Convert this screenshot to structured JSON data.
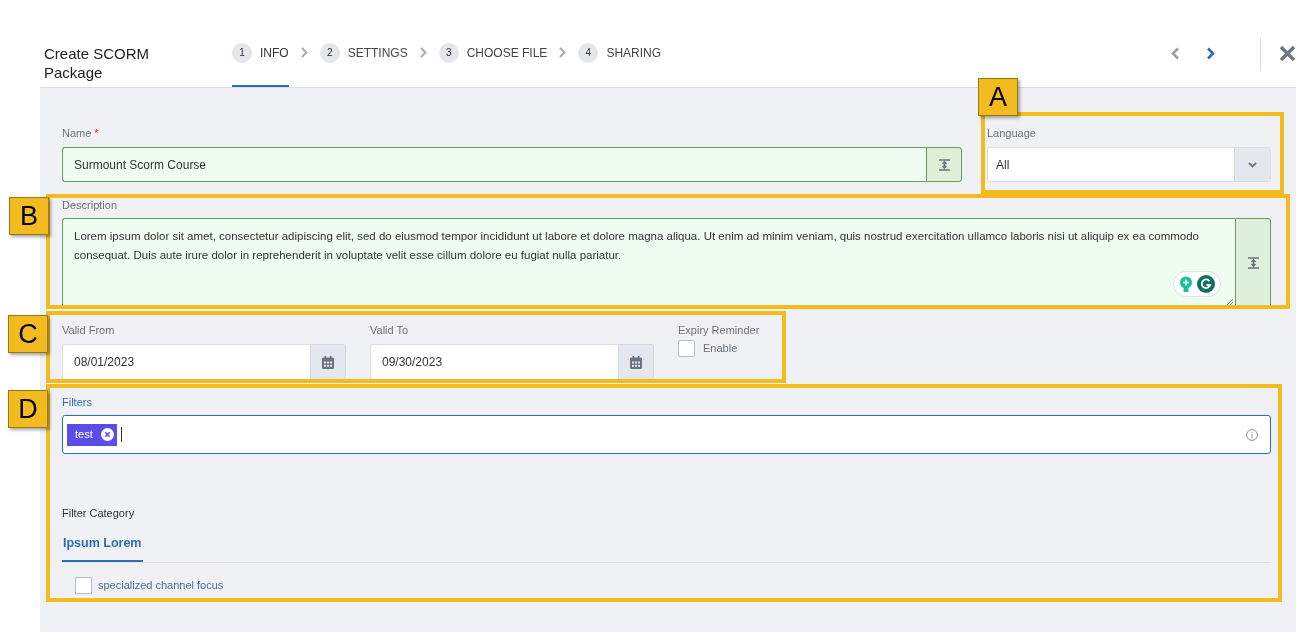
{
  "header": {
    "title": "Create SCORM Package",
    "steps": [
      {
        "number": "1",
        "label": "INFO",
        "selected": true
      },
      {
        "number": "2",
        "label": "SETTINGS",
        "selected": false
      },
      {
        "number": "3",
        "label": "CHOOSE FILE",
        "selected": false
      },
      {
        "number": "4",
        "label": "SHARING",
        "selected": false
      }
    ],
    "nav": {
      "previous_disabled": true,
      "next_disabled": false
    }
  },
  "name": {
    "label": "Name",
    "required_mark": "*",
    "value": "Surmount Scorm Course"
  },
  "language": {
    "label": "Language",
    "value": "All"
  },
  "description": {
    "label": "Description",
    "value": "Lorem ipsum dolor sit amet, consectetur adipiscing elit, sed do eiusmod tempor incididunt ut labore et dolore magna aliqua. Ut enim ad minim veniam, quis nostrud exercitation ullamco laboris nisi ut aliquip ex ea commodo consequat. Duis aute irure dolor in reprehenderit in voluptate velit esse cillum dolore eu fugiat nulla pariatur."
  },
  "valid_from": {
    "label": "Valid From",
    "value": "08/01/2023"
  },
  "valid_to": {
    "label": "Valid To",
    "value": "09/30/2023"
  },
  "expiry_reminder": {
    "label": "Expiry Reminder",
    "option": "Enable",
    "checked": false
  },
  "filters": {
    "label": "Filters",
    "chips": [
      {
        "label": "test"
      }
    ]
  },
  "filter_category": {
    "label": "Filter Category",
    "tabs": [
      {
        "label": "Ipsum Lorem",
        "selected": true
      }
    ],
    "options": [
      {
        "label": "specialized channel focus",
        "checked": false
      }
    ]
  },
  "callouts": [
    {
      "label": "A"
    },
    {
      "label": "B"
    },
    {
      "label": "C"
    },
    {
      "label": "D"
    }
  ]
}
